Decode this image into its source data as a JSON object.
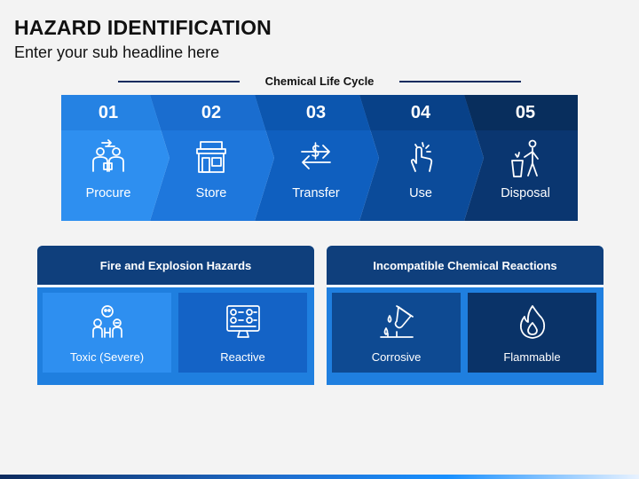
{
  "header": {
    "title": "HAZARD IDENTIFICATION",
    "subtitle": "Enter your sub headline here"
  },
  "cycle": {
    "label": "Chemical Life Cycle",
    "steps": [
      {
        "number": "01",
        "label": "Procure",
        "icon": "procurement-people-icon",
        "color": "#2e8ff0"
      },
      {
        "number": "02",
        "label": "Store",
        "icon": "store-front-icon",
        "color": "#1e77dc"
      },
      {
        "number": "03",
        "label": "Transfer",
        "icon": "dollar-transfer-icon",
        "color": "#0f5fbf"
      },
      {
        "number": "04",
        "label": "Use",
        "icon": "hand-tap-icon",
        "color": "#0b4b9a"
      },
      {
        "number": "05",
        "label": "Disposal",
        "icon": "trash-disposal-icon",
        "color": "#0a3670"
      }
    ]
  },
  "panels": [
    {
      "title": "Fire and Explosion Hazards",
      "tiles": [
        {
          "label": "Toxic (Severe)",
          "icon": "toxic-people-icon",
          "color": "#2e8ff0"
        },
        {
          "label": "Reactive",
          "icon": "reactive-monitor-icon",
          "color": "#1463c6"
        }
      ]
    },
    {
      "title": "Incompatible Chemical Reactions",
      "tiles": [
        {
          "label": "Corrosive",
          "icon": "corrosive-tube-icon",
          "color": "#0e4a92"
        },
        {
          "label": "Flammable",
          "icon": "flame-icon",
          "color": "#0a3368"
        }
      ]
    }
  ]
}
